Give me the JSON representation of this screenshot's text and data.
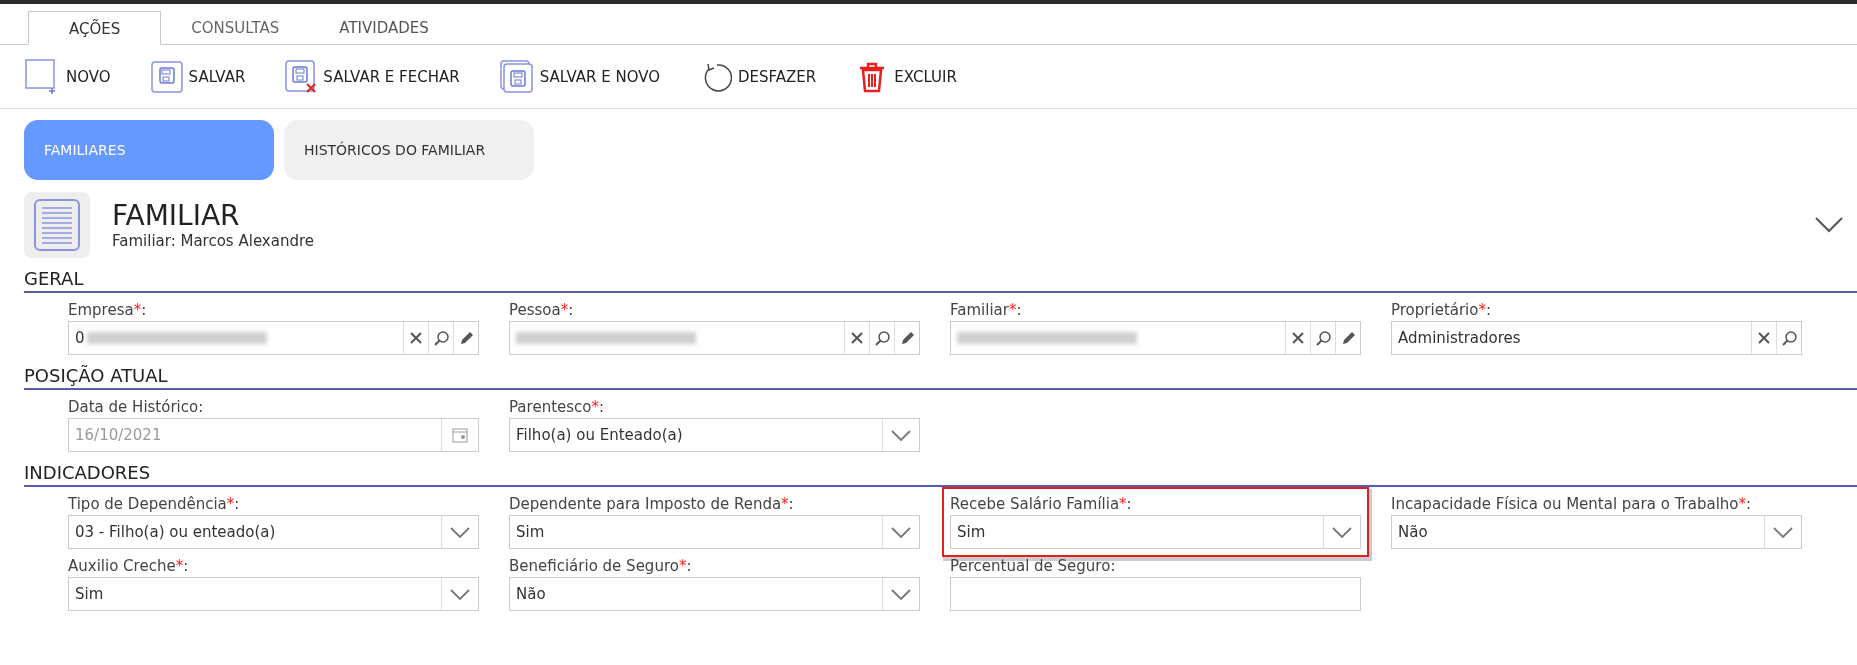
{
  "tabs": [
    {
      "label": "AÇÕES",
      "selected": true
    },
    {
      "label": "CONSULTAS",
      "selected": false
    },
    {
      "label": "ATIVIDADES",
      "selected": false
    }
  ],
  "toolbar": [
    {
      "kind": "new",
      "label": "NOVO"
    },
    {
      "kind": "save",
      "label": "SALVAR"
    },
    {
      "kind": "save_close",
      "label": "SALVAR E FECHAR"
    },
    {
      "kind": "save_new",
      "label": "SALVAR E NOVO"
    },
    {
      "kind": "undo",
      "label": "DESFAZER"
    },
    {
      "kind": "delete",
      "label": "EXCLUIR"
    }
  ],
  "subtabs": [
    {
      "label": "FAMILIARES",
      "selected": true
    },
    {
      "label": "HISTÓRICOS DO FAMILIAR",
      "selected": false
    }
  ],
  "header": {
    "title": "FAMILIAR",
    "subtitle": "Familiar: Marcos Alexandre"
  },
  "sections": [
    {
      "title": "GERAL",
      "rows": [
        [
          {
            "kind": "lookup",
            "label": "Empresa",
            "mark": "*",
            "suffix": ":",
            "value": "0",
            "redacted": true,
            "editable": true
          },
          {
            "kind": "lookup",
            "label": "Pessoa",
            "mark": "*",
            "suffix": ":",
            "redacted": true,
            "editable": true
          },
          {
            "kind": "lookup",
            "label": "Familiar",
            "mark": "*",
            "suffix": ":",
            "redacted": true,
            "editable": true
          },
          {
            "kind": "lookup",
            "label": "Proprietário",
            "mark": "*",
            "suffix": ":",
            "value": "Administradores"
          }
        ]
      ]
    },
    {
      "title": "POSIÇÃO ATUAL",
      "rows": [
        [
          {
            "kind": "date",
            "label": "Data de Histórico:",
            "value": "16/10/2021",
            "disabled": true
          },
          {
            "kind": "select",
            "label": "Parentesco",
            "mark": "*",
            "suffix": ":",
            "value": "Filho(a) ou Enteado(a)"
          }
        ]
      ]
    },
    {
      "title": "INDICADORES",
      "rows": [
        [
          {
            "kind": "select",
            "label": "Tipo de Dependência",
            "mark": "*",
            "suffix": ":",
            "value": "03 - Filho(a) ou enteado(a)"
          },
          {
            "kind": "select",
            "label": "Dependente para Imposto de Renda",
            "mark": "*",
            "suffix": ":",
            "value": "Sim"
          },
          {
            "kind": "select",
            "label": "Recebe Salário Família",
            "mark": "*",
            "suffix": ":",
            "value": "Sim",
            "highlighted": true
          },
          {
            "kind": "select",
            "label": "Incapacidade Física ou Mental para o Trabalho",
            "mark": "*",
            "suffix": ":",
            "value": "Não"
          }
        ],
        [
          {
            "kind": "select",
            "label": "Auxilio Creche",
            "mark": "*",
            "suffix": ":",
            "value": "Sim"
          },
          {
            "kind": "select",
            "label": "Beneficiário de Seguro",
            "mark": "*",
            "suffix": ":",
            "value": "Não"
          },
          {
            "kind": "text",
            "label": "Percentual de Seguro:"
          }
        ]
      ]
    }
  ]
}
